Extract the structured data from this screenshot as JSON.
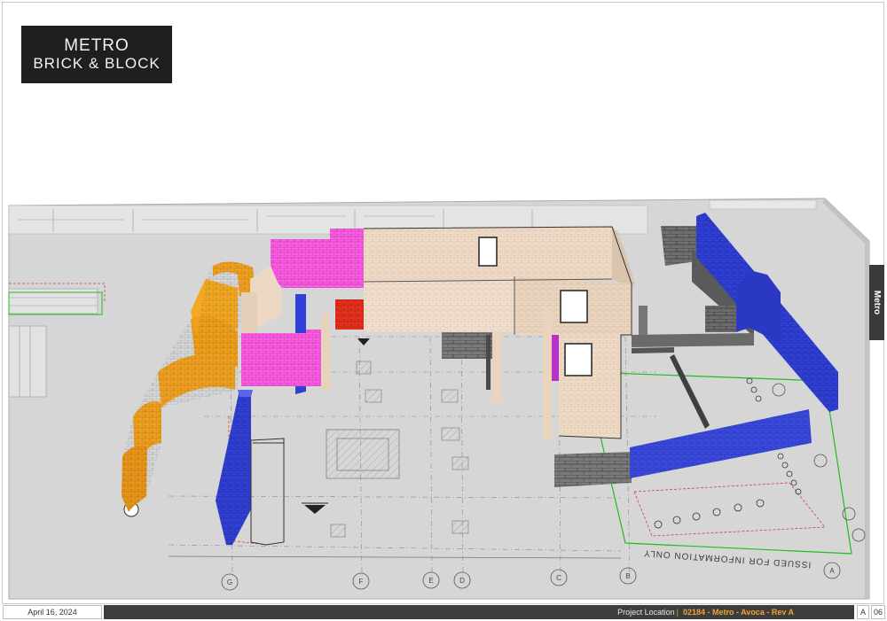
{
  "logo": {
    "line1": "METRO",
    "line2": "BRICK & BLOCK"
  },
  "side_tab": {
    "label": "Metro"
  },
  "drawing": {
    "stamp": "ISSUED FOR INFORMATION ONLY",
    "grid_labels": [
      "G",
      "F",
      "E",
      "D",
      "C",
      "B",
      "A"
    ],
    "colors": {
      "orange_curved_wall": "#f0a020",
      "magenta_wall": "#ff5ce6",
      "blue_wall": "#2f3fd8",
      "red_block": "#e8301c",
      "beige_wall": "#f0dcc6",
      "grey_block": "#777777",
      "green_boundary": "#22bb22"
    }
  },
  "footer": {
    "date": "April 16, 2024",
    "project_label": "Project Location",
    "separator": "|",
    "project_info": "02184 - Metro - Avoca - Rev A",
    "revision": "A",
    "page": "06"
  }
}
